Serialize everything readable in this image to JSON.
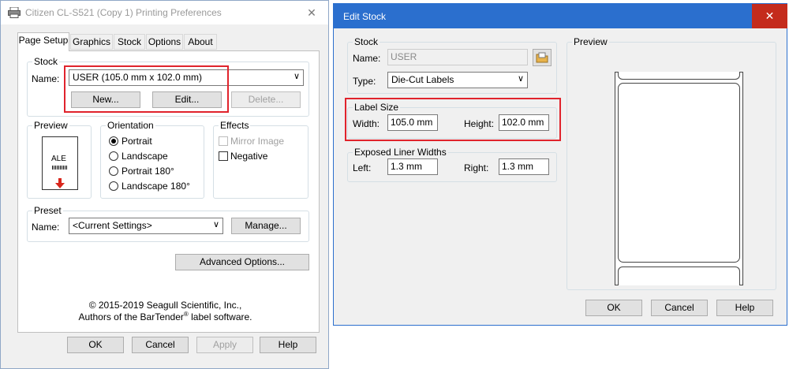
{
  "left_window": {
    "title": "Citizen CL-S521 (Copy 1) Printing Preferences",
    "close_glyph": "✕",
    "tabs": [
      {
        "label": "Page Setup"
      },
      {
        "label": "Graphics"
      },
      {
        "label": "Stock"
      },
      {
        "label": "Options"
      },
      {
        "label": "About"
      }
    ],
    "stock": {
      "group_label": "Stock",
      "name_label": "Name:",
      "name_value": "USER (105.0 mm x 102.0 mm)",
      "new_button": "New...",
      "edit_button": "Edit...",
      "delete_button": "Delete..."
    },
    "preview": {
      "group_label": "Preview",
      "sample_text": "ALE"
    },
    "orientation": {
      "group_label": "Orientation",
      "options": [
        "Portrait",
        "Landscape",
        "Portrait 180°",
        "Landscape 180°"
      ],
      "selected": "Portrait"
    },
    "effects": {
      "group_label": "Effects",
      "mirror_image": "Mirror Image",
      "negative": "Negative"
    },
    "preset": {
      "group_label": "Preset",
      "name_label": "Name:",
      "name_value": "<Current Settings>",
      "manage_button": "Manage..."
    },
    "advanced_button": "Advanced Options...",
    "copyright_line1": "© 2015-2019 Seagull Scientific, Inc.,",
    "copyright_line2_pre": "Authors of the BarTender",
    "copyright_line2_reg": "®",
    "copyright_line2_post": " label software.",
    "ok": "OK",
    "cancel": "Cancel",
    "apply": "Apply",
    "help": "Help"
  },
  "right_window": {
    "title": "Edit Stock",
    "close_glyph": "✕",
    "stock": {
      "group_label": "Stock",
      "name_label": "Name:",
      "name_value": "USER",
      "type_label": "Type:",
      "type_value": "Die-Cut Labels"
    },
    "label_size": {
      "group_label": "Label Size",
      "width_label": "Width:",
      "width_value": "105.0 mm",
      "height_label": "Height:",
      "height_value": "102.0 mm"
    },
    "liner": {
      "group_label": "Exposed Liner Widths",
      "left_label": "Left:",
      "left_value": "1.3 mm",
      "right_label": "Right:",
      "right_value": "1.3 mm"
    },
    "preview_label": "Preview",
    "ok": "OK",
    "cancel": "Cancel",
    "help": "Help"
  },
  "colors": {
    "accent_blue": "#2b6fce",
    "close_red": "#c42b1c",
    "highlight_red": "#e0232c",
    "window_bg": "#f0f0f0"
  }
}
